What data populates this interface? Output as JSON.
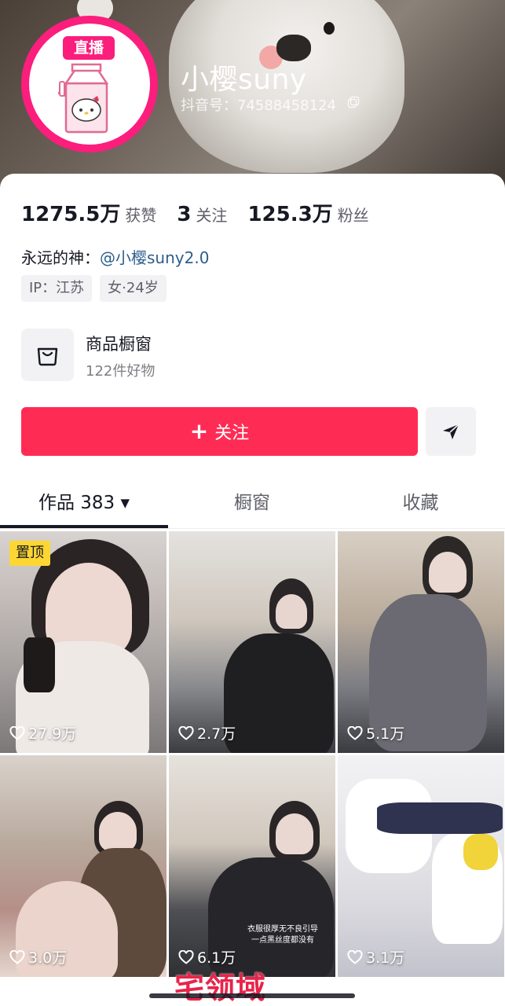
{
  "profile": {
    "live_badge": "直播",
    "nickname": "小樱suny",
    "douyin_id": "抖音号：74588458124"
  },
  "stats": {
    "likes_num": "1275.5万",
    "likes_label": "获赞",
    "following_num": "3",
    "following_label": "关注",
    "followers_num": "125.3万",
    "followers_label": "粉丝"
  },
  "bio": {
    "prefix": "永远的神：",
    "mention": "@小樱suny2.0"
  },
  "tags": [
    "IP：江苏",
    "女·24岁"
  ],
  "shop": {
    "title": "商品橱窗",
    "subtitle": "122件好物"
  },
  "actions": {
    "follow_plus": "+",
    "follow_label": "关注"
  },
  "tabs": {
    "works": "作品 383 ▾",
    "window": "橱窗",
    "favorites": "收藏"
  },
  "videos": [
    {
      "likes": "27.9万",
      "pinned": "置顶"
    },
    {
      "likes": "2.7万"
    },
    {
      "likes": "5.1万"
    },
    {
      "likes": "3.0万"
    },
    {
      "likes": "6.1万",
      "caption1": "衣服很厚无不良引导",
      "caption2": "一点黑丝度都没有"
    },
    {
      "likes": "3.1万"
    }
  ],
  "watermark": "宅领域 www.zcys.me",
  "colors": {
    "accent": "#fe2c55",
    "avatar_ring": "#fb1e7c",
    "pin_badge": "#fdd633",
    "mention": "#2d5e8c"
  }
}
